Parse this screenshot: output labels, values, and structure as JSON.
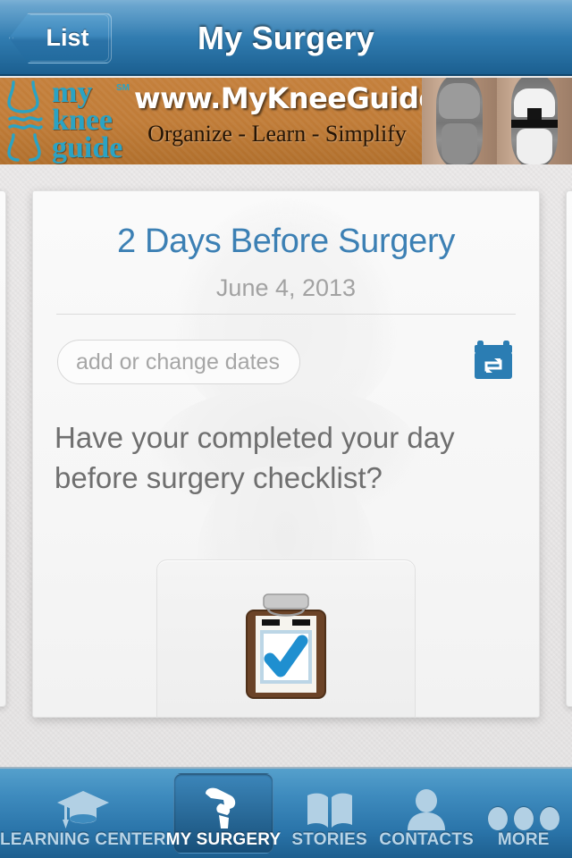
{
  "navbar": {
    "back_label": "List",
    "title": "My Surgery",
    "back_icon": "chevron-left-icon"
  },
  "banner": {
    "logo_line1": "my",
    "logo_line2": "knee",
    "logo_line3": "guide",
    "trademark": "SM",
    "url": "www.MyKneeGuide.com",
    "tagline": "Organize - Learn - Simplify",
    "xray_left_label": "natural-knee-xray",
    "xray_right_label": "knee-implant-xray",
    "bg_color": "#c07c38",
    "logo_color": "#2aa3c4"
  },
  "card": {
    "title": "2 Days Before Surgery",
    "date": "June 4, 2013",
    "date_input_placeholder": "add or change dates",
    "date_input_value": "",
    "calendar_icon": "calendar-repeat-icon",
    "question": "Have your completed your day before surgery checklist?",
    "checklist_icon": "clipboard-check-icon",
    "title_color": "#3c80b4",
    "date_color": "#a2a2a2"
  },
  "tabbar": {
    "items": [
      {
        "label": "LEARNING CENTER",
        "icon": "graduation-cap-icon",
        "active": false
      },
      {
        "label": "MY SURGERY",
        "icon": "knee-implant-icon",
        "active": true
      },
      {
        "label": "STORIES",
        "icon": "open-book-icon",
        "active": false
      },
      {
        "label": "CONTACTS",
        "icon": "person-icon",
        "active": false
      },
      {
        "label": "MORE",
        "icon": "ellipsis-icon",
        "active": false
      }
    ],
    "active_color": "#ffffff",
    "inactive_color": "#b8d4e7"
  }
}
